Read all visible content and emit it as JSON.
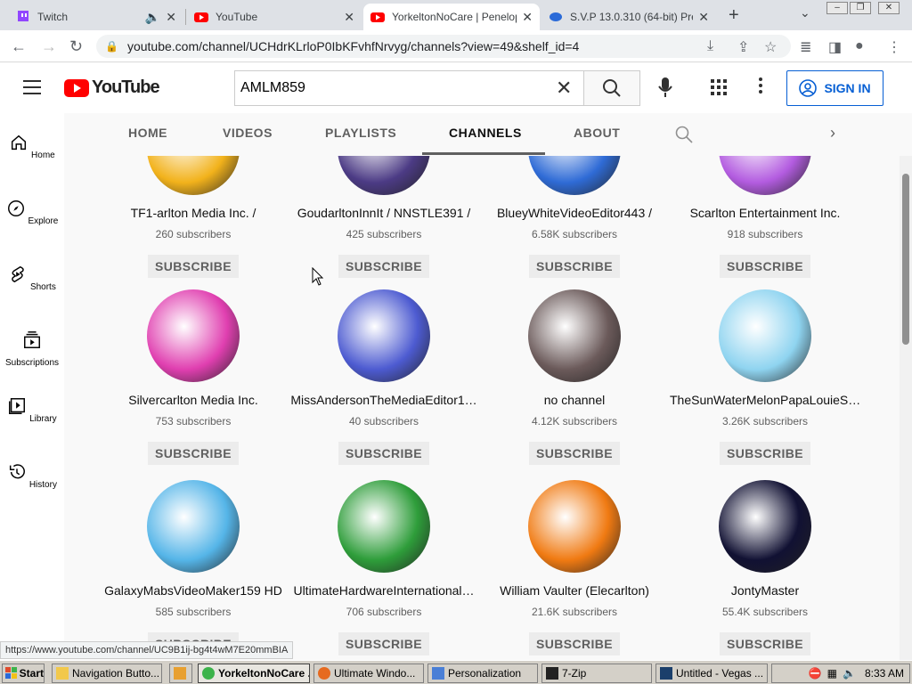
{
  "browser": {
    "tabs": [
      {
        "title": "Twitch",
        "color": "#9146ff"
      },
      {
        "title": "YouTube",
        "color": "#ff0000"
      },
      {
        "title": "YorkeltonNoCare | Penelop",
        "color": "#ff0000"
      },
      {
        "title": "S.V.P 13.0.310 (64-bit) Pre",
        "color": "#2a6ad8"
      }
    ],
    "url": "youtube.com/channel/UCHdrKLrloP0IbKFvhfNrvyg/channels?view=49&shelf_id=4"
  },
  "youtube": {
    "logo_text": "YouTube",
    "search_value": "AMLM859",
    "signin_label": "SIGN IN",
    "sidebar": [
      {
        "label": "Home",
        "icon": "home-icon"
      },
      {
        "label": "Explore",
        "icon": "compass-icon"
      },
      {
        "label": "Shorts",
        "icon": "shorts-icon"
      },
      {
        "label": "Subscriptions",
        "icon": "subscriptions-icon"
      },
      {
        "label": "Library",
        "icon": "library-icon"
      },
      {
        "label": "History",
        "icon": "history-icon"
      }
    ],
    "channel_tabs": [
      "HOME",
      "VIDEOS",
      "PLAYLISTS",
      "CHANNELS",
      "ABOUT"
    ],
    "selected_tab": "CHANNELS",
    "subscribe_label": "SUBSCRIBE",
    "channels": [
      {
        "name": "TF1-arlton Media Inc. /",
        "subs": "260 subscribers",
        "color": "#f2b21b"
      },
      {
        "name": "GoudarltonInnIt / NNSTLE391 /",
        "subs": "425 subscribers",
        "color": "#4c3b85"
      },
      {
        "name": "BlueyWhiteVideoEditor443 /",
        "subs": "6.58K subscribers",
        "color": "#2f6bd6"
      },
      {
        "name": "Scarlton Entertainment Inc.",
        "subs": "918 subscribers",
        "color": "#b35ce0"
      },
      {
        "name": "Silvercarlton Media Inc.",
        "subs": "753 subscribers",
        "color": "#e03fb0"
      },
      {
        "name": "MissAndersonTheMediaEditor1…",
        "subs": "40 subscribers",
        "color": "#4d5bd1"
      },
      {
        "name": "no channel",
        "subs": "4.12K subscribers",
        "color": "#6b5a5a"
      },
      {
        "name": "TheSunWaterMelonPapaLouieS…",
        "subs": "3.26K subscribers",
        "color": "#8fd4f0"
      },
      {
        "name": "GalaxyMabsVideoMaker159 HD",
        "subs": "585 subscribers",
        "color": "#55b5e8"
      },
      {
        "name": "UltimateHardwareInternational…",
        "subs": "706 subscribers",
        "color": "#2e9d3a"
      },
      {
        "name": "William Vaulter (Elecarlton)",
        "subs": "21.6K subscribers",
        "color": "#f07a12"
      },
      {
        "name": "JontyMaster",
        "subs": "55.4K subscribers",
        "color": "#111133"
      }
    ]
  },
  "status_url": "https://www.youtube.com/channel/UC9B1ij-bg4t4wM7E20mmBIA",
  "taskbar": {
    "start_label": "Start",
    "items": [
      "Navigation Butto...",
      "",
      "YorkeltonNoCare ...",
      "Ultimate Windo...",
      "Personalization",
      "7-Zip",
      "Untitled - Vegas ..."
    ],
    "clock": "8:33 AM"
  }
}
